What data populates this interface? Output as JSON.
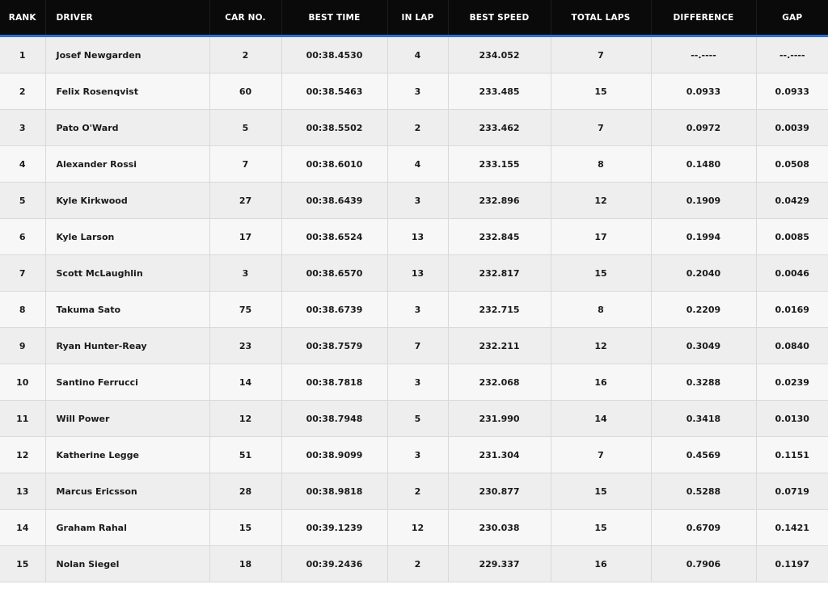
{
  "table": {
    "headers": {
      "rank": "RANK",
      "driver": "DRIVER",
      "car_no": "CAR NO.",
      "best_time": "BEST TIME",
      "in_lap": "IN LAP",
      "best_speed": "BEST SPEED",
      "total_laps": "TOTAL LAPS",
      "difference": "DIFFERENCE",
      "gap": "GAP"
    },
    "rows": [
      {
        "rank": "1",
        "driver": "Josef Newgarden",
        "car_no": "2",
        "best_time": "00:38.4530",
        "in_lap": "4",
        "best_speed": "234.052",
        "total_laps": "7",
        "difference": "--.----",
        "gap": "--.----"
      },
      {
        "rank": "2",
        "driver": "Felix Rosenqvist",
        "car_no": "60",
        "best_time": "00:38.5463",
        "in_lap": "3",
        "best_speed": "233.485",
        "total_laps": "15",
        "difference": "0.0933",
        "gap": "0.0933"
      },
      {
        "rank": "3",
        "driver": "Pato O'Ward",
        "car_no": "5",
        "best_time": "00:38.5502",
        "in_lap": "2",
        "best_speed": "233.462",
        "total_laps": "7",
        "difference": "0.0972",
        "gap": "0.0039"
      },
      {
        "rank": "4",
        "driver": "Alexander Rossi",
        "car_no": "7",
        "best_time": "00:38.6010",
        "in_lap": "4",
        "best_speed": "233.155",
        "total_laps": "8",
        "difference": "0.1480",
        "gap": "0.0508"
      },
      {
        "rank": "5",
        "driver": "Kyle Kirkwood",
        "car_no": "27",
        "best_time": "00:38.6439",
        "in_lap": "3",
        "best_speed": "232.896",
        "total_laps": "12",
        "difference": "0.1909",
        "gap": "0.0429"
      },
      {
        "rank": "6",
        "driver": "Kyle Larson",
        "car_no": "17",
        "best_time": "00:38.6524",
        "in_lap": "13",
        "best_speed": "232.845",
        "total_laps": "17",
        "difference": "0.1994",
        "gap": "0.0085"
      },
      {
        "rank": "7",
        "driver": "Scott McLaughlin",
        "car_no": "3",
        "best_time": "00:38.6570",
        "in_lap": "13",
        "best_speed": "232.817",
        "total_laps": "15",
        "difference": "0.2040",
        "gap": "0.0046"
      },
      {
        "rank": "8",
        "driver": "Takuma Sato",
        "car_no": "75",
        "best_time": "00:38.6739",
        "in_lap": "3",
        "best_speed": "232.715",
        "total_laps": "8",
        "difference": "0.2209",
        "gap": "0.0169"
      },
      {
        "rank": "9",
        "driver": "Ryan Hunter-Reay",
        "car_no": "23",
        "best_time": "00:38.7579",
        "in_lap": "7",
        "best_speed": "232.211",
        "total_laps": "12",
        "difference": "0.3049",
        "gap": "0.0840"
      },
      {
        "rank": "10",
        "driver": "Santino Ferrucci",
        "car_no": "14",
        "best_time": "00:38.7818",
        "in_lap": "3",
        "best_speed": "232.068",
        "total_laps": "16",
        "difference": "0.3288",
        "gap": "0.0239"
      },
      {
        "rank": "11",
        "driver": "Will Power",
        "car_no": "12",
        "best_time": "00:38.7948",
        "in_lap": "5",
        "best_speed": "231.990",
        "total_laps": "14",
        "difference": "0.3418",
        "gap": "0.0130"
      },
      {
        "rank": "12",
        "driver": "Katherine Legge",
        "car_no": "51",
        "best_time": "00:38.9099",
        "in_lap": "3",
        "best_speed": "231.304",
        "total_laps": "7",
        "difference": "0.4569",
        "gap": "0.1151"
      },
      {
        "rank": "13",
        "driver": "Marcus Ericsson",
        "car_no": "28",
        "best_time": "00:38.9818",
        "in_lap": "2",
        "best_speed": "230.877",
        "total_laps": "15",
        "difference": "0.5288",
        "gap": "0.0719"
      },
      {
        "rank": "14",
        "driver": "Graham Rahal",
        "car_no": "15",
        "best_time": "00:39.1239",
        "in_lap": "12",
        "best_speed": "230.038",
        "total_laps": "15",
        "difference": "0.6709",
        "gap": "0.1421"
      },
      {
        "rank": "15",
        "driver": "Nolan Siegel",
        "car_no": "18",
        "best_time": "00:39.2436",
        "in_lap": "2",
        "best_speed": "229.337",
        "total_laps": "16",
        "difference": "0.7906",
        "gap": "0.1197"
      }
    ]
  }
}
